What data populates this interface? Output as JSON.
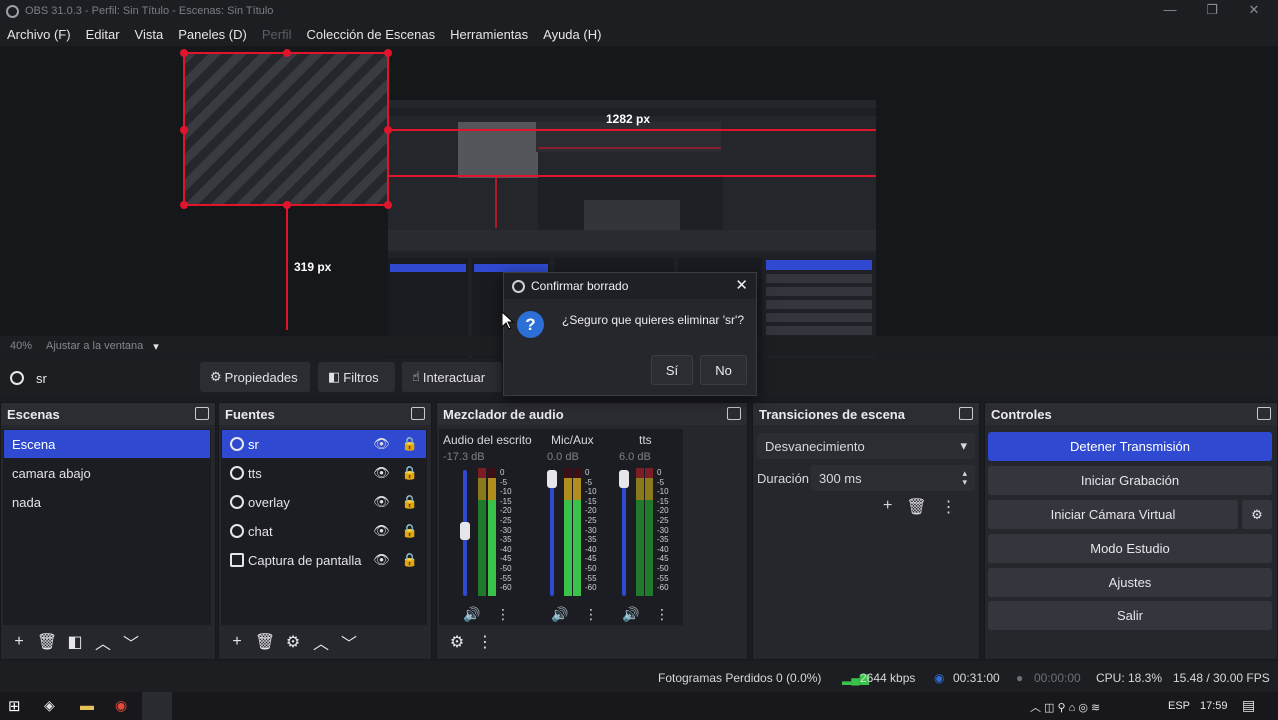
{
  "window": {
    "title": "OBS 31.0.3 - Perfil: Sin Título - Escenas: Sin Título"
  },
  "menu": [
    "Archivo (F)",
    "Editar",
    "Vista",
    "Paneles (D)",
    "Perfil",
    "Colección de Escenas",
    "Herramientas",
    "Ayuda (H)"
  ],
  "preview": {
    "width_label": "1282 px",
    "height_label": "319 px"
  },
  "zoom": {
    "percent": "40%",
    "fit_label": "Ajustar a la ventana"
  },
  "source_toolbar": {
    "source_name": "sr",
    "properties": "Propiedades",
    "filters": "Filtros",
    "interact": "Interactuar"
  },
  "scenes": {
    "title": "Escenas",
    "items": [
      "Escena",
      "camara abajo",
      "nada"
    ],
    "selected_index": 0
  },
  "sources": {
    "title": "Fuentes",
    "items": [
      "sr",
      "tts",
      "overlay",
      "chat",
      "Captura de pantalla"
    ],
    "selected_index": 0
  },
  "mixer": {
    "title": "Mezclador de audio",
    "channels": [
      {
        "name": "Audio del escrito",
        "db": "-17.3 dB",
        "level": 0.55
      },
      {
        "name": "Mic/Aux",
        "db": "0.0 dB",
        "level": 1.0
      },
      {
        "name": "tts",
        "db": "6.0 dB",
        "level": 1.0
      }
    ],
    "scale": [
      "0",
      "-5",
      "-10",
      "-15",
      "-20",
      "-25",
      "-30",
      "-35",
      "-40",
      "-45",
      "-50",
      "-55",
      "-60"
    ]
  },
  "transitions": {
    "title": "Transiciones de escena",
    "selected": "Desvanecimiento",
    "duration_label": "Duración",
    "duration_value": "300 ms"
  },
  "controls": {
    "title": "Controles",
    "buttons": [
      "Detener Transmisión",
      "Iniciar Grabación",
      "Iniciar Cámara Virtual",
      "Modo Estudio",
      "Ajustes",
      "Salir"
    ]
  },
  "dialog": {
    "title": "Confirmar borrado",
    "message": "¿Seguro que quieres eliminar 'sr'?",
    "yes": "Sí",
    "no": "No"
  },
  "status": {
    "dropped": "Fotogramas Perdidos 0 (0.0%)",
    "bitrate": "2644 kbps",
    "stream_time": "00:31:00",
    "rec_time": "00:00:00",
    "cpu": "CPU: 18.3%",
    "fps": "15.48 / 30.00 FPS"
  },
  "taskbar": {
    "lang": "ESP",
    "time": "17:59"
  },
  "colors": {
    "accent": "#2f4ad0",
    "live": "#3ac24b",
    "guide": "#e0142b"
  }
}
